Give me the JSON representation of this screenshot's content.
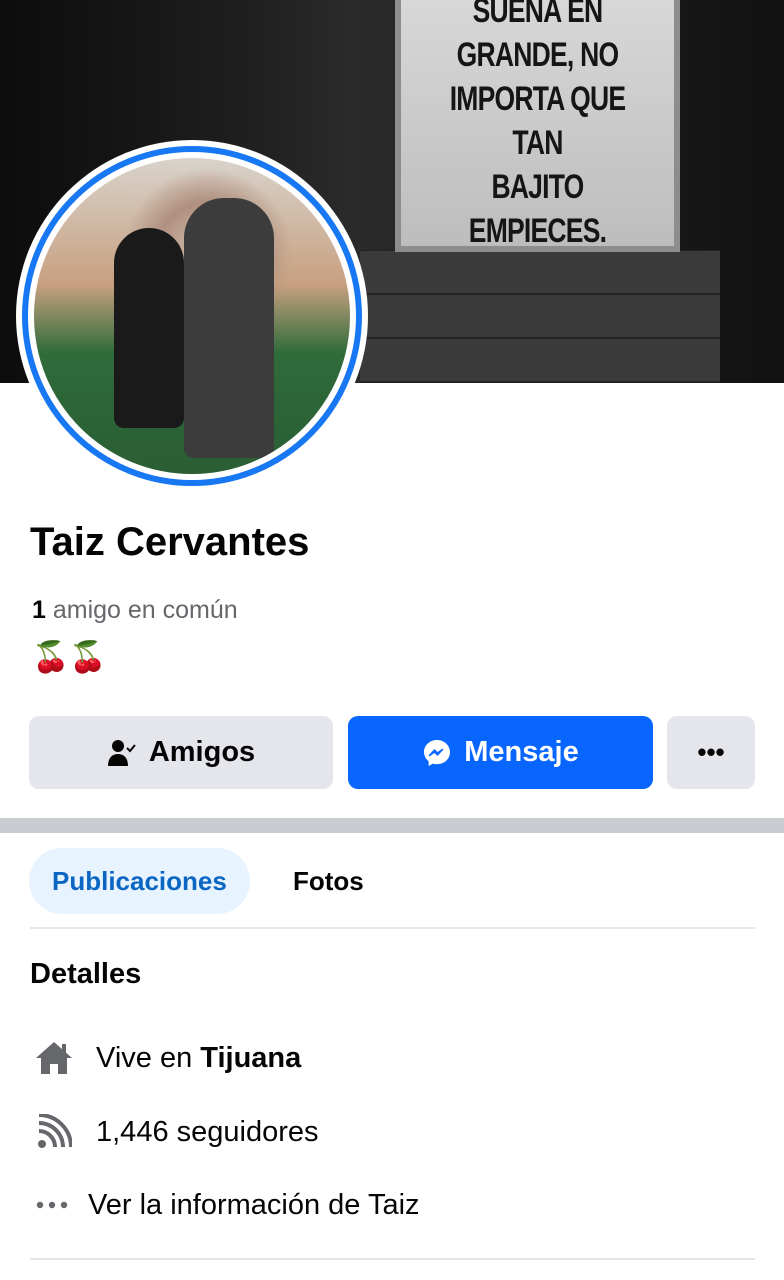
{
  "cover": {
    "sign_text": "SUEÑA EN\nGRANDE, NO\nIMPORTA QUE TAN\nBAJITO EMPIECES."
  },
  "profile": {
    "name": "Taiz Cervantes",
    "mutual_count": "1",
    "mutual_label": " amigo en común",
    "bio": "🍒🍒"
  },
  "actions": {
    "friends": "Amigos",
    "message": "Mensaje",
    "more": "•••"
  },
  "colors": {
    "accent": "#0866ff",
    "ring": "#1877f2"
  },
  "tabs": [
    {
      "label": "Publicaciones",
      "active": true
    },
    {
      "label": "Fotos",
      "active": false
    }
  ],
  "details": {
    "title": "Detalles",
    "lives_prefix": "Vive en ",
    "lives_city": "Tijuana",
    "followers": "1,446 seguidores",
    "more_info": "Ver la información de Taiz"
  }
}
